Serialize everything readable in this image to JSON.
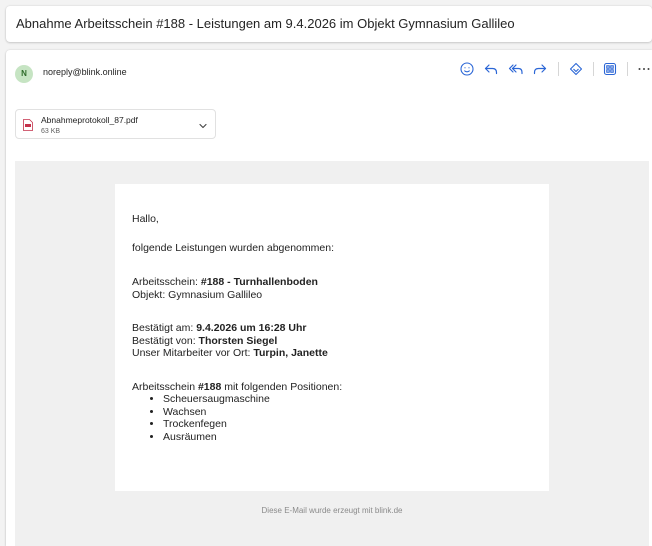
{
  "subject": "Abnahme Arbeitsschein #188 - Leistungen am  9.4.2026 im Objekt Gymnasium Gallileo",
  "sender": {
    "initial": "N",
    "email": "noreply@blink.online"
  },
  "toolbar": {
    "icons": [
      "emoji-icon",
      "reply-icon",
      "reply-all-icon",
      "forward-icon",
      "immersive-reader-icon",
      "apps-icon",
      "more-icon"
    ]
  },
  "attachment": {
    "name": "Abnahmeprotokoll_87.pdf",
    "size": "63 KB"
  },
  "body": {
    "greeting": "Hallo,",
    "intro": "folgende Leistungen wurden abgenommen:",
    "work_order_label": "Arbeitsschein: ",
    "work_order_value": "#188 - Turnhallenboden",
    "object_line": "Objekt: Gymnasium Gallileo",
    "confirmed_at_label": "Bestätigt am: ",
    "confirmed_at_value": "9.4.2026 um 16:28 Uhr",
    "confirmed_by_label": "Bestätigt von: ",
    "confirmed_by_value": "Thorsten Siegel",
    "staff_label": "Unser Mitarbeiter vor Ort: ",
    "staff_value": "Turpin, Janette",
    "positions_prefix": "Arbeitsschein ",
    "positions_number": "#188",
    "positions_suffix": " mit folgenden Positionen:",
    "positions": [
      "Scheuersaugmaschine",
      "Wachsen",
      "Trockenfegen",
      "Ausräumen"
    ],
    "footer": "Diese E-Mail wurde erzeugt mit blink.de"
  },
  "colors": {
    "accent": "#2b66d6",
    "avatar_bg": "#c6e4c3",
    "avatar_fg": "#2e6b2a",
    "pdf_red": "#c4314b"
  }
}
